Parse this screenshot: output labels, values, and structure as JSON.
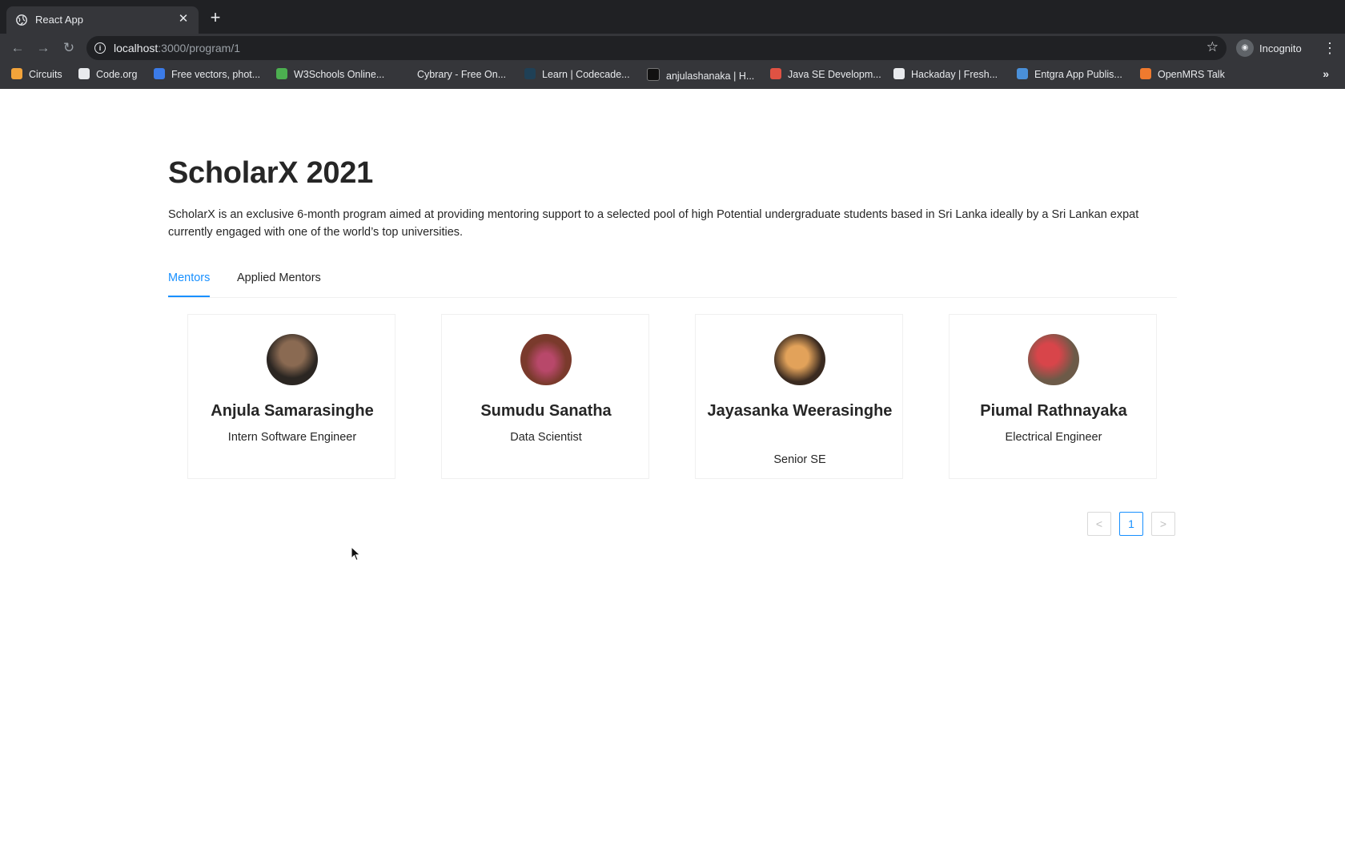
{
  "browser": {
    "tab_title": "React App",
    "url_host": "localhost",
    "url_path": ":3000/program/1",
    "profile_label": "Incognito",
    "bookmarks": [
      {
        "label": "Circuits",
        "color": "#f2a33a"
      },
      {
        "label": "Code.org",
        "color": "#e8eaed"
      },
      {
        "label": "Free vectors, phot...",
        "color": "#3b7be8"
      },
      {
        "label": "W3Schools Online...",
        "color": "#4caf50"
      },
      {
        "label": "Cybrary - Free On...",
        "color": "#35363a"
      },
      {
        "label": "Learn | Codecade...",
        "color": "#1f4056"
      },
      {
        "label": "anjulashanaka | H...",
        "color": "#111111"
      },
      {
        "label": "Java SE Developm...",
        "color": "#e05243"
      },
      {
        "label": "Hackaday | Fresh...",
        "color": "#e8eaed"
      },
      {
        "label": "Entgra App Publis...",
        "color": "#4a90d9"
      },
      {
        "label": "OpenMRS Talk",
        "color": "#f07a2e"
      }
    ],
    "more_bookmarks": "»"
  },
  "program": {
    "title": "ScholarX 2021",
    "description": "ScholarX is an exclusive 6-month program aimed at providing mentoring support to a selected pool of high Potential undergraduate students based in Sri Lanka ideally by a Sri Lankan expat currently engaged with one of the world’s top universities."
  },
  "tabs": [
    {
      "label": "Mentors",
      "active": true
    },
    {
      "label": "Applied Mentors",
      "active": false
    }
  ],
  "mentors": [
    {
      "name": "Anjula Samarasinghe",
      "role": "Intern Software Engineer",
      "avatar_colors": [
        "#2b2622",
        "#8a6a52"
      ]
    },
    {
      "name": "Sumudu Sanatha",
      "role": "Data Scientist",
      "avatar_colors": [
        "#7a3a2c",
        "#b8486a"
      ]
    },
    {
      "name": "Jayasanka Weerasinghe",
      "role": "Senior SE",
      "avatar_colors": [
        "#3a2a20",
        "#e2a25a"
      ]
    },
    {
      "name": "Piumal Rathnayaka",
      "role": "Electrical Engineer",
      "avatar_colors": [
        "#6c5a48",
        "#d8454a"
      ]
    }
  ],
  "pagination": {
    "prev": "<",
    "current": "1",
    "next": ">"
  },
  "colors": {
    "accent": "#1890ff",
    "text": "#262626",
    "border": "#f0f0f0"
  }
}
